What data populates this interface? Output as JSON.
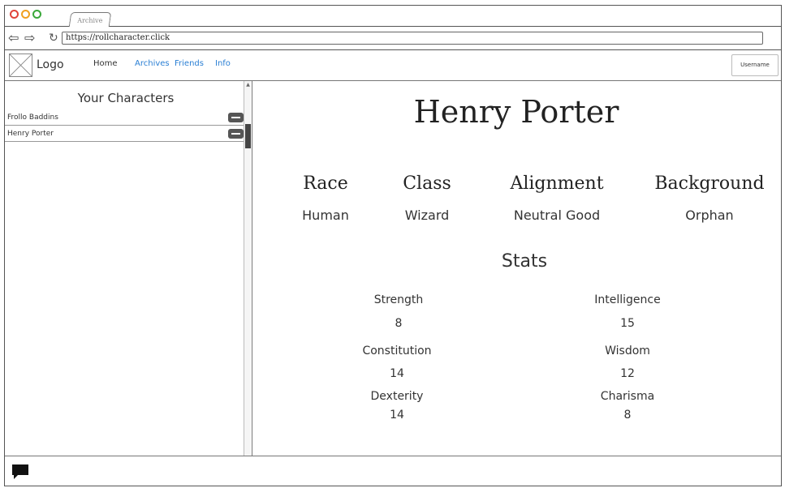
{
  "browser": {
    "tab_label": "Archive",
    "url": "https://rollcharacter.click"
  },
  "header": {
    "logo_text": "Logo",
    "nav": {
      "home": "Home",
      "archives": "Archives",
      "friends": "Friends",
      "info": "Info"
    },
    "username": "Username"
  },
  "sidebar": {
    "title": "Your Characters",
    "characters": [
      {
        "name": "Frollo Baddins"
      },
      {
        "name": "Henry Porter"
      }
    ]
  },
  "main": {
    "character_name": "Henry Porter",
    "attributes": [
      {
        "label": "Race",
        "value": "Human"
      },
      {
        "label": "Class",
        "value": "Wizard"
      },
      {
        "label": "Alignment",
        "value": "Neutral Good"
      },
      {
        "label": "Background",
        "value": "Orphan"
      }
    ],
    "stats_title": "Stats",
    "stats": {
      "strength": {
        "label": "Strength",
        "value": "8"
      },
      "intelligence": {
        "label": "Intelligence",
        "value": "15"
      },
      "constitution": {
        "label": "Constitution",
        "value": "14"
      },
      "wisdom": {
        "label": "Wisdom",
        "value": "12"
      },
      "dexterity": {
        "label": "Dexterity",
        "value": "14"
      },
      "charisma": {
        "label": "Charisma",
        "value": "8"
      }
    }
  },
  "colors": {
    "link": "#2a7fd4",
    "close_dot": "#e0443a",
    "minimize_dot": "#f0a020",
    "maximize_dot": "#3aa83a"
  },
  "icons": {
    "chat": "chat-bubble-icon",
    "image_placeholder": "logo-placeholder-icon"
  }
}
